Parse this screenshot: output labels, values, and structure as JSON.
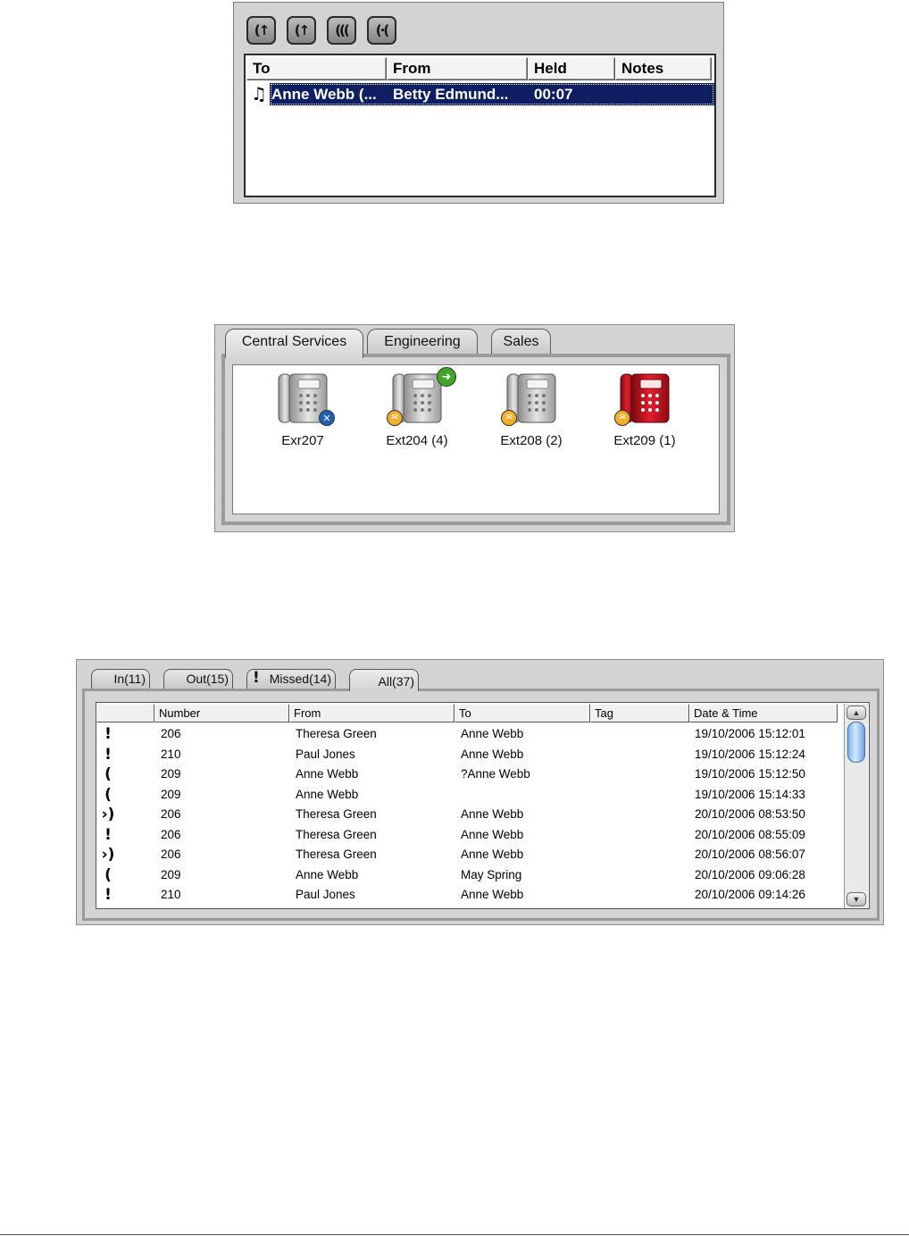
{
  "held_panel": {
    "toolbar_icons": [
      "retrieve-call-icon",
      "transfer-call-icon",
      "conference-icon",
      "park-call-icon"
    ],
    "toolbar_glyphs": [
      "(↑",
      "(↑",
      "(((",
      "(·("
    ],
    "columns": [
      "To",
      "From",
      "Held",
      "Notes"
    ],
    "row": {
      "icon": "music-note-icon",
      "glyph": "♫",
      "to": "Anne Webb (...",
      "from": "Betty Edmund...",
      "held": "00:07",
      "notes": ""
    },
    "selection_color": "#0e1f63"
  },
  "group_panel": {
    "tabs": [
      "Central Services",
      "Engineering",
      "Sales"
    ],
    "active_tab": "Central Services",
    "phones": [
      {
        "label": "Exr207",
        "color": "grey",
        "badge": "dnd-cross-icon"
      },
      {
        "label": "Ext204 (4)",
        "color": "grey",
        "badge": "forward-arrow-icon",
        "voicemail": true
      },
      {
        "label": "Ext208 (2)",
        "color": "grey",
        "voicemail": true
      },
      {
        "label": "Ext209 (1)",
        "color": "red",
        "voicemail": true
      }
    ]
  },
  "log_panel": {
    "tabs": [
      "In(11)",
      "Out(15)",
      "Missed(14)",
      "All(37)"
    ],
    "active_tab": "All(37)",
    "columns": [
      "",
      "Number",
      "From",
      "To",
      "Tag",
      "Date & Time"
    ],
    "rows": [
      {
        "type": "missed",
        "glyph": "!",
        "number": "206",
        "from": "Theresa Green",
        "to": "Anne Webb",
        "tag": "",
        "datetime": "19/10/2006 15:12:01"
      },
      {
        "type": "missed",
        "glyph": "!",
        "number": "210",
        "from": "Paul Jones",
        "to": "Anne Webb",
        "tag": "",
        "datetime": "19/10/2006 15:12:24"
      },
      {
        "type": "outgoing",
        "glyph": "(",
        "number": "209",
        "from": "Anne Webb",
        "to": "?Anne Webb",
        "tag": "",
        "datetime": "19/10/2006 15:12:50"
      },
      {
        "type": "outgoing",
        "glyph": "(",
        "number": "209",
        "from": "Anne Webb",
        "to": "",
        "tag": "",
        "datetime": "19/10/2006 15:14:33"
      },
      {
        "type": "incoming",
        "glyph": "›)",
        "number": "206",
        "from": "Theresa Green",
        "to": "Anne Webb",
        "tag": "",
        "datetime": "20/10/2006 08:53:50"
      },
      {
        "type": "missed",
        "glyph": "!",
        "number": "206",
        "from": "Theresa Green",
        "to": "Anne Webb",
        "tag": "",
        "datetime": "20/10/2006 08:55:09"
      },
      {
        "type": "incoming",
        "glyph": "›)",
        "number": "206",
        "from": "Theresa Green",
        "to": "Anne Webb",
        "tag": "",
        "datetime": "20/10/2006 08:56:07"
      },
      {
        "type": "outgoing",
        "glyph": "(",
        "number": "209",
        "from": "Anne Webb",
        "to": "May Spring",
        "tag": "",
        "datetime": "20/10/2006 09:06:28"
      },
      {
        "type": "missed",
        "glyph": "!",
        "number": "210",
        "from": "Paul Jones",
        "to": "Anne Webb",
        "tag": "",
        "datetime": "20/10/2006 09:14:26"
      }
    ],
    "scroll_position": 0.0
  }
}
